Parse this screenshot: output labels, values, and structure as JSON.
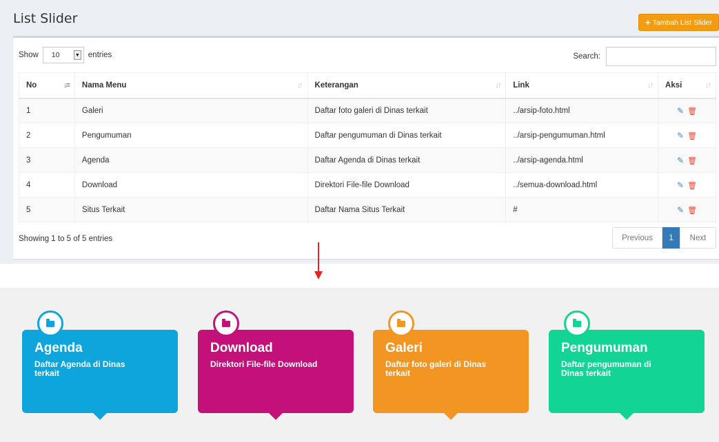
{
  "page": {
    "title": "List Slider",
    "add_button_label": "Tambah List Slider"
  },
  "table_controls": {
    "show_label": "Show",
    "entries_value": "10",
    "entries_label": "entries",
    "search_label": "Search:",
    "search_value": ""
  },
  "table": {
    "columns": [
      "No",
      "Nama Menu",
      "Keterangan",
      "Link",
      "Aksi"
    ],
    "rows": [
      {
        "no": "1",
        "nama": "Galeri",
        "keterangan": "Daftar foto galeri di Dinas terkait",
        "link": "../arsip-foto.html"
      },
      {
        "no": "2",
        "nama": "Pengumuman",
        "keterangan": "Daftar pengumuman di Dinas terkait",
        "link": "../arsip-pengumuman.html"
      },
      {
        "no": "3",
        "nama": "Agenda",
        "keterangan": "Daftar Agenda di Dinas terkait",
        "link": "../arsip-agenda.html"
      },
      {
        "no": "4",
        "nama": "Download",
        "keterangan": "Direktori File-file Download",
        "link": "../semua-download.html"
      },
      {
        "no": "5",
        "nama": "Situs Terkait",
        "keterangan": "Daftar Nama Situs Terkait",
        "link": "#"
      }
    ]
  },
  "footer": {
    "info": "Showing 1 to 5 of 5 entries",
    "prev_label": "Previous",
    "current_page": "1",
    "next_label": "Next"
  },
  "slider": {
    "cards": [
      {
        "title": "Agenda",
        "desc": "Daftar Agenda di Dinas terkait",
        "color": "#0ea5dc",
        "icon": "folder-open-icon"
      },
      {
        "title": "Download",
        "desc": "Direktori File-file Download",
        "color": "#c4117a",
        "icon": "folder-open-icon"
      },
      {
        "title": "Galeri",
        "desc": "Daftar foto galeri di Dinas terkait",
        "color": "#f29522",
        "icon": "folder-open-icon"
      },
      {
        "title": "Pengumuman",
        "desc": "Daftar pengumuman di Dinas terkait",
        "color": "#12d495",
        "icon": "folder-open-icon"
      }
    ]
  },
  "colors": {
    "add_button": "#f39c12",
    "pagination_active": "#337ab7",
    "edit_icon": "#3c8dbc",
    "delete_icon": "#dd4b39",
    "arrow": "#e12626"
  }
}
